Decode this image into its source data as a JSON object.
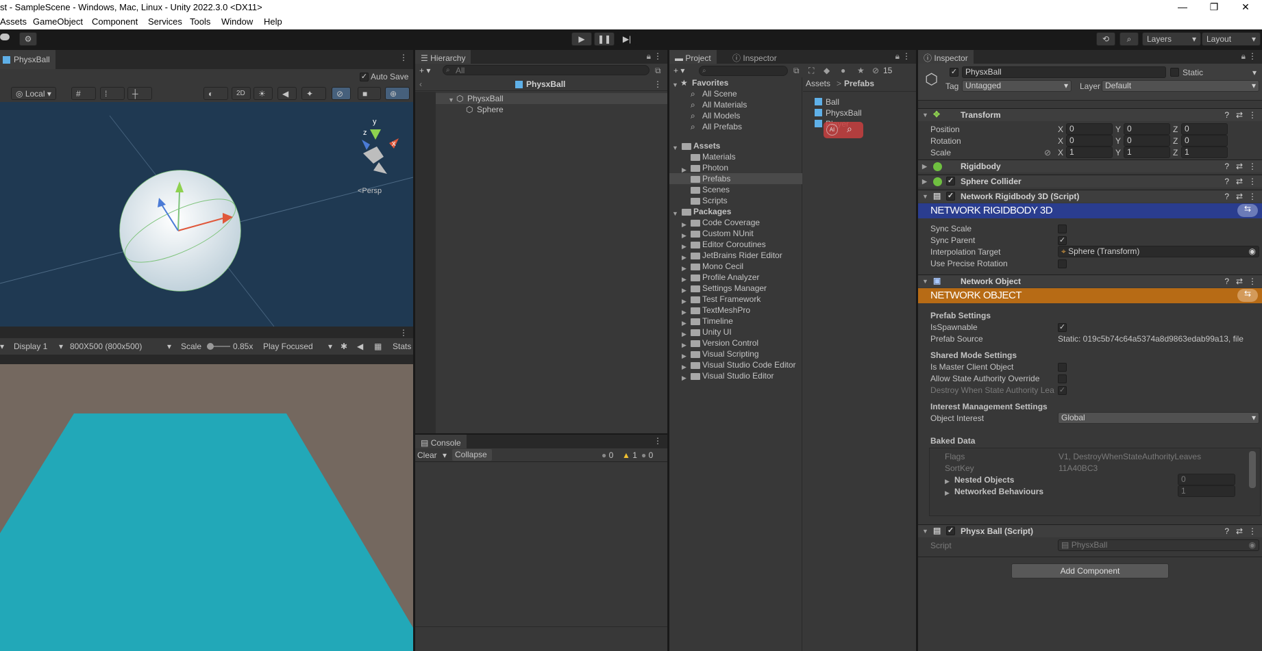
{
  "window": {
    "title": "st - SampleScene - Windows, Mac, Linux - Unity 2022.3.0 <DX11>",
    "controls": [
      "—",
      "❐",
      "✕"
    ]
  },
  "menu": [
    "Assets",
    "GameObject",
    "Component",
    "Services",
    "Tools",
    "Window",
    "Help"
  ],
  "toolbar": {
    "layers": "Layers",
    "layout": "Layout"
  },
  "scene": {
    "tab": "PhysxBall",
    "auto_save": "Auto Save",
    "pivot": "Local",
    "mode_2d": "2D",
    "persp": "<Persp",
    "gizmo_axes": {
      "x": "x",
      "y": "y",
      "z": "z"
    }
  },
  "game": {
    "display": "Display 1",
    "resolution": "800X500 (800x500)",
    "scale_label": "Scale",
    "scale_value": "0.85x",
    "play_mode": "Play Focused",
    "stats": "Stats"
  },
  "hierarchy": {
    "tab": "Hierarchy",
    "search_placeholder": "All",
    "prefab_header": "PhysxBall",
    "items": [
      "PhysxBall",
      "Sphere"
    ]
  },
  "console": {
    "tab": "Console",
    "clear": "Clear",
    "collapse": "Collapse",
    "counts": {
      "log": "0",
      "warn": "1",
      "error": "0"
    }
  },
  "project": {
    "tabs": [
      "Project",
      "Inspector"
    ],
    "hidden_count": "15",
    "favorites_label": "Favorites",
    "favorites": [
      "All Scene",
      "All Materials",
      "All Models",
      "All Prefabs"
    ],
    "assets_label": "Assets",
    "assets": [
      "Materials",
      "Photon",
      "Prefabs",
      "Scenes",
      "Scripts"
    ],
    "packages_label": "Packages",
    "packages": [
      "Code Coverage",
      "Custom NUnit",
      "Editor Coroutines",
      "JetBrains Rider Editor",
      "Mono Cecil",
      "Profile Analyzer",
      "Settings Manager",
      "Test Framework",
      "TextMeshPro",
      "Timeline",
      "Unity UI",
      "Version Control",
      "Visual Scripting",
      "Visual Studio Code Editor",
      "Visual Studio Editor"
    ],
    "breadcrumb": [
      "Assets",
      "Prefabs"
    ],
    "files": [
      "Ball",
      "PhysxBall",
      "Player"
    ]
  },
  "inspector": {
    "tab": "Inspector",
    "object_name": "PhysxBall",
    "static": "Static",
    "tag_label": "Tag",
    "tag_value": "Untagged",
    "layer_label": "Layer",
    "layer_value": "Default",
    "transform": {
      "title": "Transform",
      "rows": [
        {
          "label": "Position",
          "x": "0",
          "y": "0",
          "z": "0"
        },
        {
          "label": "Rotation",
          "x": "0",
          "y": "0",
          "z": "0"
        },
        {
          "label": "Scale",
          "x": "1",
          "y": "1",
          "z": "1"
        }
      ]
    },
    "rigidbody": "Rigidbody",
    "sphere_collider": "Sphere Collider",
    "nrb": {
      "title": "Network Rigidbody 3D (Script)",
      "banner": "NETWORK RIGIDBODY 3D",
      "sync_scale": "Sync Scale",
      "sync_parent": "Sync Parent",
      "interp_target": "Interpolation Target",
      "interp_value": "Sphere (Transform)",
      "use_precise": "Use Precise Rotation"
    },
    "netobj": {
      "title": "Network Object",
      "banner": "NETWORK OBJECT",
      "prefab_settings": "Prefab Settings",
      "is_spawnable": "IsSpawnable",
      "prefab_source": "Prefab Source",
      "prefab_source_value": "Static: 019c5b74c64a5374a8d9863edab99a13, file",
      "shared_mode": "Shared Mode Settings",
      "is_master": "Is Master Client Object",
      "allow_state": "Allow State Authority Override",
      "destroy_when": "Destroy When State Authority Lea",
      "interest": "Interest Management Settings",
      "object_interest": "Object Interest",
      "object_interest_value": "Global",
      "baked": "Baked Data",
      "flags": "Flags",
      "flags_value": "V1, DestroyWhenStateAuthorityLeaves",
      "sortkey": "SortKey",
      "sortkey_value": "11A40BC3",
      "nested": "Nested Objects",
      "nested_value": "0",
      "networked": "Networked Behaviours",
      "networked_value": "1"
    },
    "physx": {
      "title": "Physx Ball (Script)",
      "script_label": "Script",
      "script_value": "PhysxBall"
    },
    "add_component": "Add Component"
  }
}
